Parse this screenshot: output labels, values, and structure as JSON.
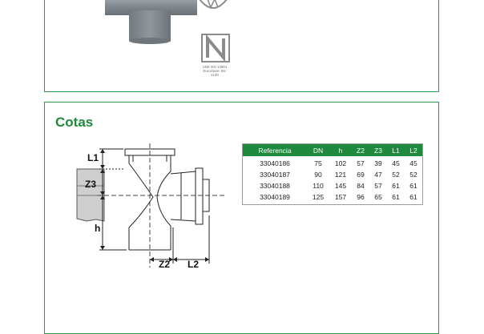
{
  "certification": {
    "logo_letter": "N",
    "standard": "UNE EN 13801",
    "reaction": "Euroclase: Bs-s1d0"
  },
  "section": {
    "title": "Cotas"
  },
  "diagram": {
    "labels": {
      "l1": "L1",
      "z3": "Z3",
      "h": "h",
      "z2": "Z2",
      "l2": "L2"
    }
  },
  "table": {
    "headers": [
      "Referencia",
      "DN",
      "h",
      "Z2",
      "Z3",
      "L1",
      "L2"
    ],
    "rows": [
      [
        "33040186",
        "75",
        "102",
        "57",
        "39",
        "45",
        "45"
      ],
      [
        "33040187",
        "90",
        "121",
        "69",
        "47",
        "52",
        "52"
      ],
      [
        "33040188",
        "110",
        "145",
        "84",
        "57",
        "61",
        "61"
      ],
      [
        "33040189",
        "125",
        "157",
        "96",
        "65",
        "61",
        "61"
      ]
    ]
  },
  "colors": {
    "accent": "#1f8a3d",
    "border": "#2e9a4f",
    "pipe": "#8e969c"
  }
}
